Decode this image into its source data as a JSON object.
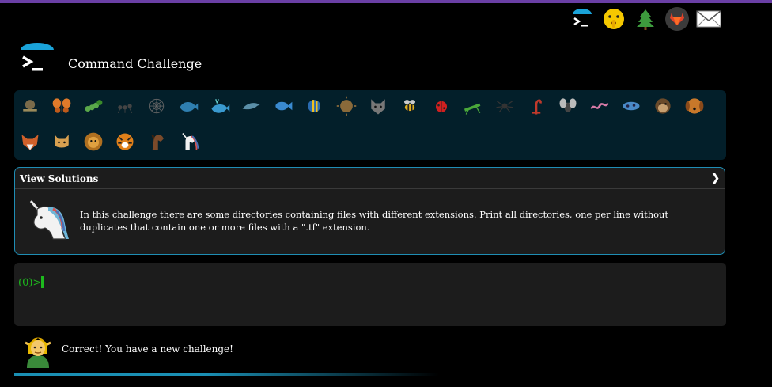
{
  "app": {
    "title": "Command Challenge"
  },
  "header_icons": [
    "terminal-logo-icon",
    "shushing-face-icon",
    "tree-icon",
    "gitlab-icon",
    "envelope-icon"
  ],
  "zoo": {
    "row1": [
      "snail",
      "butterfly",
      "caterpillar",
      "ant",
      "spider-web",
      "whale",
      "whale-spout",
      "dolphin",
      "fish",
      "tropical-fish",
      "blowfish",
      "wolf",
      "bee",
      "ladybug",
      "cricket",
      "spider",
      "scorpion",
      "fly",
      "worm",
      "microbe",
      "monkey",
      "dog"
    ],
    "row2": [
      "fox",
      "cat",
      "lion",
      "tiger",
      "horse",
      "unicorn"
    ]
  },
  "solutions": {
    "header": "View Solutions",
    "chevron": "❯",
    "description": "In this challenge there are some directories containing files with different extensions. Print all directories, one per line without duplicates that contain one or more files with a \".tf\" extension."
  },
  "terminal": {
    "prompt": "(0)>"
  },
  "status": {
    "message": "Correct! You have a new challenge!"
  },
  "progress": {
    "fraction": 0.55
  },
  "colors": {
    "accent": "#1f8db4",
    "prompt_green": "#1db91d",
    "top_bar": "#6a3fa5",
    "zoo_bg": "#031f2a"
  }
}
